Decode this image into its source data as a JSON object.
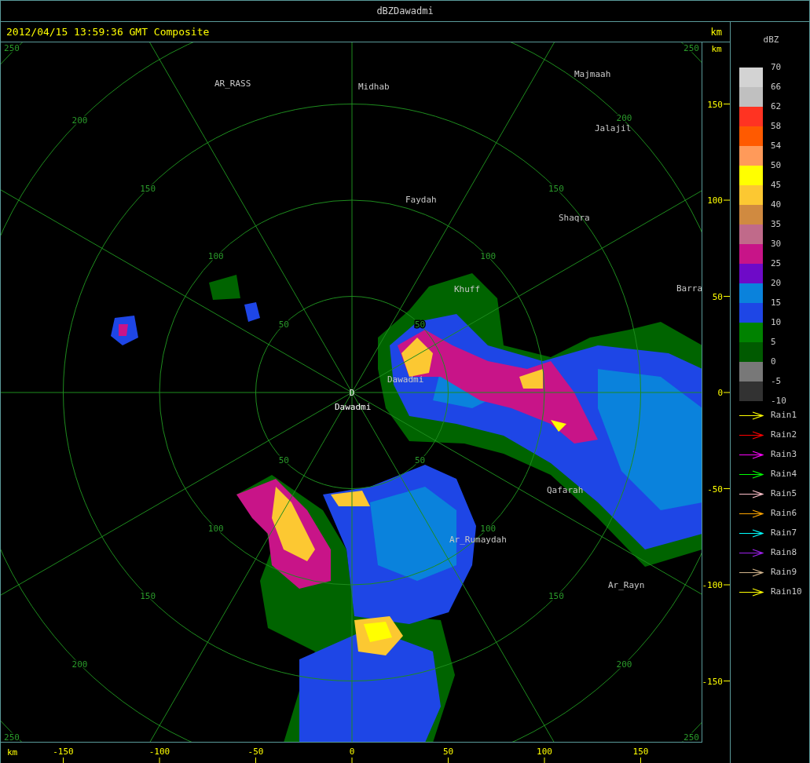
{
  "window": {
    "title": "dBZDawadmi"
  },
  "header": {
    "timestamp": "2012/04/15 13:59:36 GMT Composite",
    "unit": "km"
  },
  "radar_map": {
    "center_marker": "D",
    "range_rings": [
      {
        "labels": [
          "50",
          "50",
          "50",
          "50"
        ]
      },
      {
        "labels": [
          "100",
          "100",
          "100",
          "100"
        ]
      },
      {
        "labels": [
          "150",
          "150",
          "150",
          "150"
        ]
      },
      {
        "labels": [
          "200",
          "200",
          "200",
          "200"
        ]
      },
      {
        "labels": [
          "250",
          "250",
          "250",
          "250"
        ]
      }
    ],
    "places": [
      "Majmaah",
      "AR_RASS",
      "Midhab",
      "Jalajil",
      "Faydah",
      "Shaqra",
      "Barra",
      "Khuff",
      "Dawadmi",
      "Dawadmi",
      "Qafarah",
      "Ar_Rumaydah",
      "Ar_Rayn"
    ]
  },
  "right_axis": {
    "unit": "km",
    "ticks": [
      "150",
      "100",
      "50",
      "0",
      "-50",
      "-100",
      "-150"
    ]
  },
  "bottom_axis": {
    "unit": "km",
    "ticks": [
      "-150",
      "-100",
      "-50",
      "0",
      "50",
      "100",
      "150"
    ]
  },
  "legend": {
    "title": "dBZ",
    "scale_labels": [
      "70",
      "66",
      "62",
      "58",
      "54",
      "50",
      "45",
      "40",
      "35",
      "30",
      "25",
      "20",
      "15",
      "10",
      "5",
      "0",
      "-5",
      "-10"
    ],
    "bands": [
      {
        "color": "#d3d3d3"
      },
      {
        "color": "#c0c0c0"
      },
      {
        "color": "#ff3322"
      },
      {
        "color": "#ff5a00"
      },
      {
        "color": "#ff9a5a"
      },
      {
        "color": "#ffff00"
      },
      {
        "color": "#fcc832"
      },
      {
        "color": "#d08a40"
      },
      {
        "color": "#c06a8a"
      },
      {
        "color": "#c81488"
      },
      {
        "color": "#6e0ac8"
      },
      {
        "color": "#0a82dc"
      },
      {
        "color": "#1e46e6"
      },
      {
        "color": "#008200"
      },
      {
        "color": "#005a00"
      },
      {
        "color": "#787878"
      },
      {
        "color": "#323232"
      }
    ],
    "tracks": [
      {
        "label": "Rain1",
        "color": "#ffff00"
      },
      {
        "label": "Rain2",
        "color": "#ff0000"
      },
      {
        "label": "Rain3",
        "color": "#ff00ff"
      },
      {
        "label": "Rain4",
        "color": "#00ff00"
      },
      {
        "label": "Rain5",
        "color": "#ffc0cb"
      },
      {
        "label": "Rain6",
        "color": "#ffa500"
      },
      {
        "label": "Rain7",
        "color": "#00ffff"
      },
      {
        "label": "Rain8",
        "color": "#a020f0"
      },
      {
        "label": "Rain9",
        "color": "#d2b48c"
      },
      {
        "label": "Rain10",
        "color": "#ffff00"
      }
    ]
  }
}
